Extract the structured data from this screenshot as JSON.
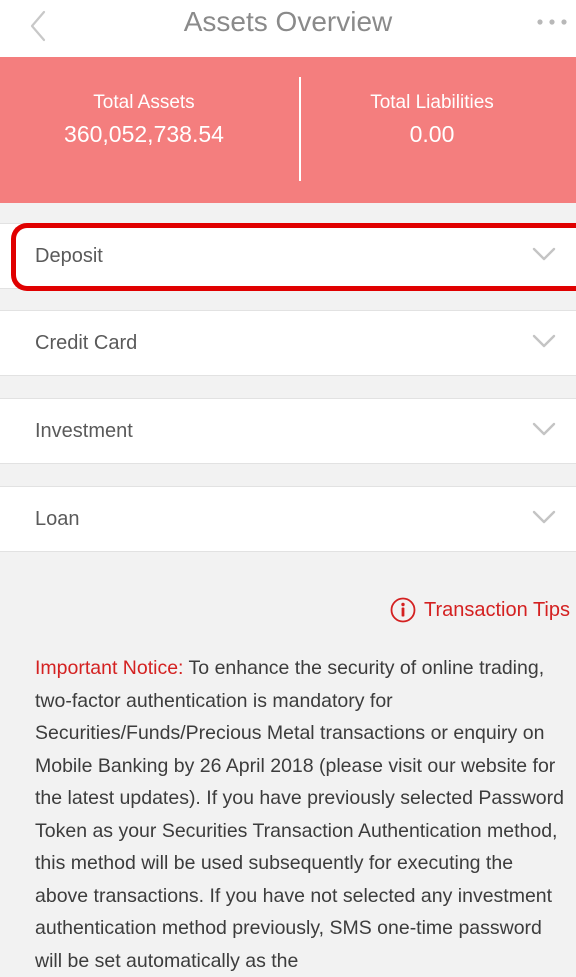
{
  "header": {
    "title": "Assets Overview"
  },
  "summary": {
    "total_assets": {
      "label": "Total Assets",
      "value": "360,052,738.54"
    },
    "total_liabilities": {
      "label": "Total Liabilities",
      "value": "0.00"
    }
  },
  "categories": [
    {
      "label": "Deposit",
      "icon": "chevron-down-icon"
    },
    {
      "label": "Credit Card",
      "icon": "chevron-down-icon"
    },
    {
      "label": "Investment",
      "icon": "chevron-down-icon"
    },
    {
      "label": "Loan",
      "icon": "chevron-down-icon"
    }
  ],
  "tips": {
    "label": "Transaction Tips",
    "icon": "info-icon"
  },
  "notice": {
    "label": "Important Notice:",
    "text": " To enhance the security of online trading, two-factor authentication is mandatory for Securities/Funds/Precious Metal transactions or enquiry on Mobile Banking by 26 April 2018 (please visit our website for the latest updates). If you have previously selected Password Token as your Securities Transaction Authentication method, this method will be used subsequently for executing the above transactions. If you have not selected any investment authentication method previously, SMS one-time password will be set automatically as the"
  },
  "colors": {
    "summary_background": "#f47e7e",
    "accent_red": "#d42121",
    "highlight_border": "#e00000"
  }
}
